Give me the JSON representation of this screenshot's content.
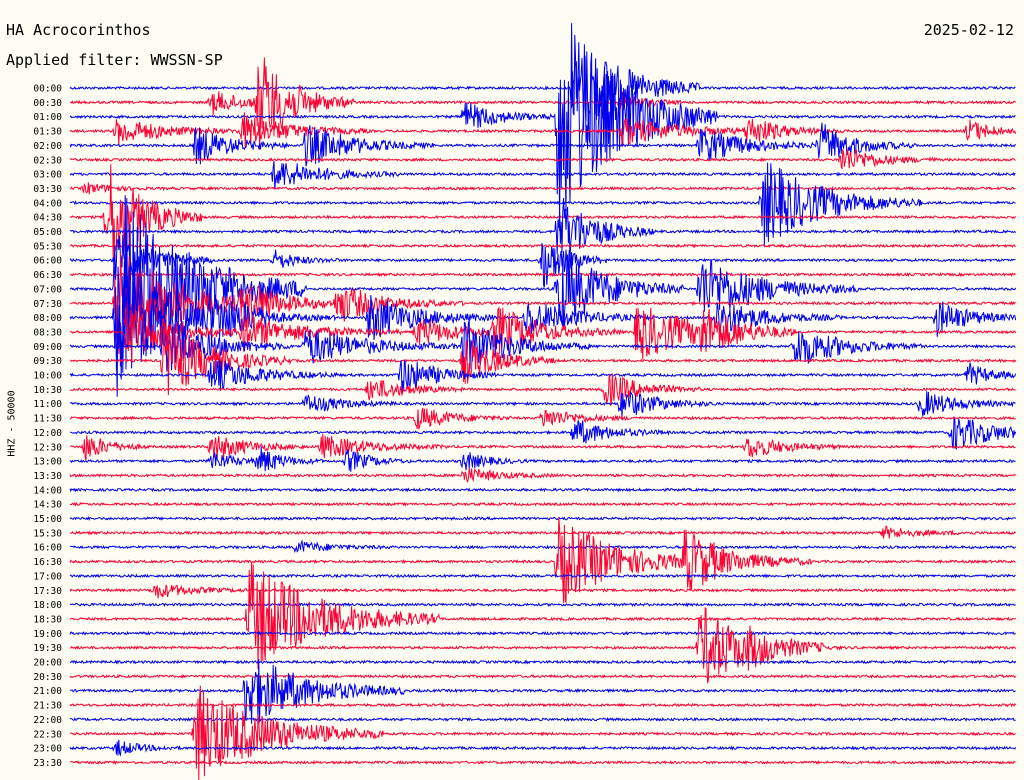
{
  "header": {
    "station": "HA Acrocorinthos",
    "date": "2025-02-12",
    "filter": "Applied filter: WWSSN-SP",
    "y_label": "HHZ - 50000"
  },
  "colors": {
    "background": "#fdfdf3",
    "trace_a": "#0000ee",
    "trace_b": "#ff0033"
  },
  "chart_data": {
    "type": "line",
    "chart_kind": "helicorder",
    "y_tick_labels": [
      "00:00",
      "00:30",
      "01:00",
      "01:30",
      "02:00",
      "02:30",
      "03:00",
      "03:30",
      "04:00",
      "04:30",
      "05:00",
      "05:30",
      "06:00",
      "06:30",
      "07:00",
      "07:30",
      "08:00",
      "08:30",
      "09:00",
      "09:30",
      "10:00",
      "10:30",
      "11:00",
      "11:30",
      "12:00",
      "12:30",
      "13:00",
      "13:30",
      "14:00",
      "14:30",
      "15:00",
      "15:30",
      "16:00",
      "16:30",
      "17:00",
      "17:30",
      "18:00",
      "18:30",
      "19:00",
      "19:30",
      "20:00",
      "20:30",
      "21:00",
      "21:30",
      "22:00",
      "22:30",
      "23:00",
      "23:30"
    ],
    "series_colors": [
      "#0000ee",
      "#ff0033"
    ],
    "minutes_per_line": 30,
    "events": [
      {
        "line": 0,
        "minute": 16.0,
        "amp": 60,
        "len": 4
      },
      {
        "line": 1,
        "minute": 6.0,
        "amp": 50,
        "len": 3
      },
      {
        "line": 1,
        "minute": 4.5,
        "amp": 12,
        "len": 3
      },
      {
        "line": 1,
        "minute": 17.5,
        "amp": 10,
        "len": 2
      },
      {
        "line": 2,
        "minute": 12.5,
        "amp": 16,
        "len": 3
      },
      {
        "line": 2,
        "minute": 15.5,
        "amp": 120,
        "len": 5
      },
      {
        "line": 3,
        "minute": 1.5,
        "amp": 14,
        "len": 4
      },
      {
        "line": 3,
        "minute": 5.5,
        "amp": 18,
        "len": 4
      },
      {
        "line": 3,
        "minute": 17.5,
        "amp": 14,
        "len": 5
      },
      {
        "line": 3,
        "minute": 21.5,
        "amp": 14,
        "len": 3
      },
      {
        "line": 3,
        "minute": 28.5,
        "amp": 12,
        "len": 2
      },
      {
        "line": 4,
        "minute": 4.0,
        "amp": 20,
        "len": 3
      },
      {
        "line": 4,
        "minute": 7.5,
        "amp": 22,
        "len": 4
      },
      {
        "line": 4,
        "minute": 20.0,
        "amp": 18,
        "len": 4
      },
      {
        "line": 4,
        "minute": 23.8,
        "amp": 22,
        "len": 3
      },
      {
        "line": 5,
        "minute": 24.5,
        "amp": 14,
        "len": 3
      },
      {
        "line": 6,
        "minute": 6.5,
        "amp": 16,
        "len": 4
      },
      {
        "line": 7,
        "minute": 0.5,
        "amp": 6,
        "len": 2
      },
      {
        "line": 8,
        "minute": 22.0,
        "amp": 45,
        "len": 5
      },
      {
        "line": 9,
        "minute": 1.2,
        "amp": 60,
        "len": 3
      },
      {
        "line": 10,
        "minute": 15.5,
        "amp": 40,
        "len": 3
      },
      {
        "line": 12,
        "minute": 1.5,
        "amp": 30,
        "len": 3
      },
      {
        "line": 12,
        "minute": 6.5,
        "amp": 10,
        "len": 2
      },
      {
        "line": 12,
        "minute": 15.0,
        "amp": 30,
        "len": 2
      },
      {
        "line": 14,
        "minute": 1.5,
        "amp": 110,
        "len": 6
      },
      {
        "line": 14,
        "minute": 15.5,
        "amp": 45,
        "len": 4
      },
      {
        "line": 14,
        "minute": 20.0,
        "amp": 35,
        "len": 5
      },
      {
        "line": 15,
        "minute": 1.5,
        "amp": 60,
        "len": 5
      },
      {
        "line": 15,
        "minute": 5.5,
        "amp": 20,
        "len": 4
      },
      {
        "line": 15,
        "minute": 8.5,
        "amp": 18,
        "len": 4
      },
      {
        "line": 16,
        "minute": 1.5,
        "amp": 65,
        "len": 5
      },
      {
        "line": 16,
        "minute": 4.5,
        "amp": 18,
        "len": 4
      },
      {
        "line": 16,
        "minute": 9.5,
        "amp": 25,
        "len": 4
      },
      {
        "line": 16,
        "minute": 14.5,
        "amp": 20,
        "len": 4
      },
      {
        "line": 16,
        "minute": 20.5,
        "amp": 20,
        "len": 4
      },
      {
        "line": 16,
        "minute": 27.5,
        "amp": 18,
        "len": 3
      },
      {
        "line": 17,
        "minute": 1.8,
        "amp": 30,
        "len": 4
      },
      {
        "line": 17,
        "minute": 5.5,
        "amp": 18,
        "len": 5
      },
      {
        "line": 17,
        "minute": 11.0,
        "amp": 14,
        "len": 4
      },
      {
        "line": 17,
        "minute": 13.5,
        "amp": 25,
        "len": 4
      },
      {
        "line": 17,
        "minute": 18.0,
        "amp": 30,
        "len": 5
      },
      {
        "line": 17,
        "minute": 20.0,
        "amp": 20,
        "len": 3
      },
      {
        "line": 18,
        "minute": 3.0,
        "amp": 30,
        "len": 4
      },
      {
        "line": 18,
        "minute": 7.5,
        "amp": 20,
        "len": 5
      },
      {
        "line": 18,
        "minute": 12.5,
        "amp": 28,
        "len": 4
      },
      {
        "line": 18,
        "minute": 23.0,
        "amp": 22,
        "len": 4
      },
      {
        "line": 19,
        "minute": 3.0,
        "amp": 40,
        "len": 4
      },
      {
        "line": 19,
        "minute": 12.5,
        "amp": 25,
        "len": 3
      },
      {
        "line": 20,
        "minute": 4.5,
        "amp": 18,
        "len": 4
      },
      {
        "line": 20,
        "minute": 10.5,
        "amp": 20,
        "len": 3
      },
      {
        "line": 20,
        "minute": 28.5,
        "amp": 12,
        "len": 2
      },
      {
        "line": 21,
        "minute": 9.5,
        "amp": 12,
        "len": 3
      },
      {
        "line": 21,
        "minute": 17.0,
        "amp": 18,
        "len": 3
      },
      {
        "line": 22,
        "minute": 7.5,
        "amp": 10,
        "len": 3
      },
      {
        "line": 22,
        "minute": 17.5,
        "amp": 16,
        "len": 3
      },
      {
        "line": 22,
        "minute": 27.0,
        "amp": 14,
        "len": 3
      },
      {
        "line": 23,
        "minute": 11.0,
        "amp": 12,
        "len": 3
      },
      {
        "line": 23,
        "minute": 15.0,
        "amp": 10,
        "len": 3
      },
      {
        "line": 24,
        "minute": 16.0,
        "amp": 14,
        "len": 3
      },
      {
        "line": 24,
        "minute": 28.0,
        "amp": 18,
        "len": 4
      },
      {
        "line": 25,
        "minute": 0.5,
        "amp": 14,
        "len": 2
      },
      {
        "line": 25,
        "minute": 4.5,
        "amp": 14,
        "len": 3
      },
      {
        "line": 25,
        "minute": 8.0,
        "amp": 12,
        "len": 4
      },
      {
        "line": 25,
        "minute": 21.5,
        "amp": 12,
        "len": 3
      },
      {
        "line": 26,
        "minute": 4.5,
        "amp": 10,
        "len": 2
      },
      {
        "line": 26,
        "minute": 6.0,
        "amp": 14,
        "len": 2
      },
      {
        "line": 26,
        "minute": 8.8,
        "amp": 12,
        "len": 2
      },
      {
        "line": 26,
        "minute": 12.5,
        "amp": 10,
        "len": 2
      },
      {
        "line": 27,
        "minute": 12.5,
        "amp": 8,
        "len": 3
      },
      {
        "line": 31,
        "minute": 25.8,
        "amp": 6,
        "len": 3
      },
      {
        "line": 33,
        "minute": 15.5,
        "amp": 45,
        "len": 5
      },
      {
        "line": 33,
        "minute": 19.5,
        "amp": 30,
        "len": 4
      },
      {
        "line": 32,
        "minute": 7.2,
        "amp": 6,
        "len": 3
      },
      {
        "line": 35,
        "minute": 2.7,
        "amp": 8,
        "len": 3
      },
      {
        "line": 37,
        "minute": 5.7,
        "amp": 60,
        "len": 6
      },
      {
        "line": 39,
        "minute": 20.0,
        "amp": 45,
        "len": 4
      },
      {
        "line": 39,
        "minute": 21.5,
        "amp": 8,
        "len": 3
      },
      {
        "line": 42,
        "minute": 5.6,
        "amp": 40,
        "len": 5
      },
      {
        "line": 45,
        "minute": 4.0,
        "amp": 50,
        "len": 6
      },
      {
        "line": 46,
        "minute": 1.5,
        "amp": 8,
        "len": 2
      }
    ]
  }
}
